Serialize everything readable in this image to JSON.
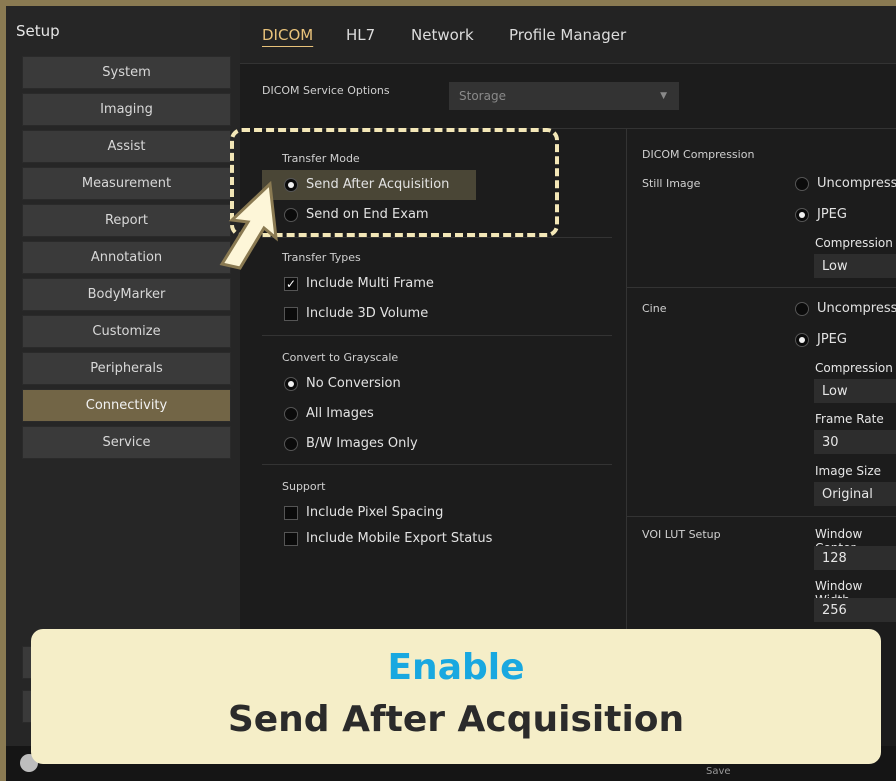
{
  "setup_title": "Setup",
  "sidebar": {
    "items": [
      {
        "label": "System"
      },
      {
        "label": "Imaging"
      },
      {
        "label": "Assist"
      },
      {
        "label": "Measurement"
      },
      {
        "label": "Report"
      },
      {
        "label": "Annotation"
      },
      {
        "label": "BodyMarker"
      },
      {
        "label": "Customize"
      },
      {
        "label": "Peripherals"
      },
      {
        "label": "Connectivity",
        "active": true
      },
      {
        "label": "Service"
      }
    ]
  },
  "tabs": [
    "DICOM",
    "HL7",
    "Network",
    "Profile Manager"
  ],
  "service_options": {
    "label": "DICOM Service Options",
    "value": "Storage"
  },
  "transfer_mode": {
    "label": "Transfer Mode",
    "options": [
      "Send After Acquisition",
      "Send on End Exam"
    ]
  },
  "transfer_types": {
    "label": "Transfer Types",
    "options": [
      "Include Multi Frame",
      "Include 3D Volume"
    ]
  },
  "grayscale": {
    "label": "Convert to Grayscale",
    "options": [
      "No Conversion",
      "All Images",
      "B/W Images Only"
    ]
  },
  "support": {
    "label": "Support",
    "options": [
      "Include Pixel Spacing",
      "Include Mobile Export Status"
    ]
  },
  "compression": {
    "label": "DICOM Compression",
    "still_label": "Still Image",
    "cine_label": "Cine",
    "uncompressed": "Uncompressed",
    "jpeg": "JPEG",
    "compression_label": "Compression",
    "still_value": "Low",
    "cine_value": "Low",
    "frame_rate_label": "Frame Rate",
    "frame_rate": "30",
    "image_size_label": "Image Size",
    "image_size": "Original"
  },
  "voi": {
    "label": "VOI LUT Setup",
    "center_label": "Window Center",
    "center": "128",
    "width_label": "Window Width",
    "width": "256"
  },
  "tooltip": {
    "line1": "Enable",
    "line2": "Send After Acquisition"
  },
  "status": {
    "save": "Save"
  }
}
